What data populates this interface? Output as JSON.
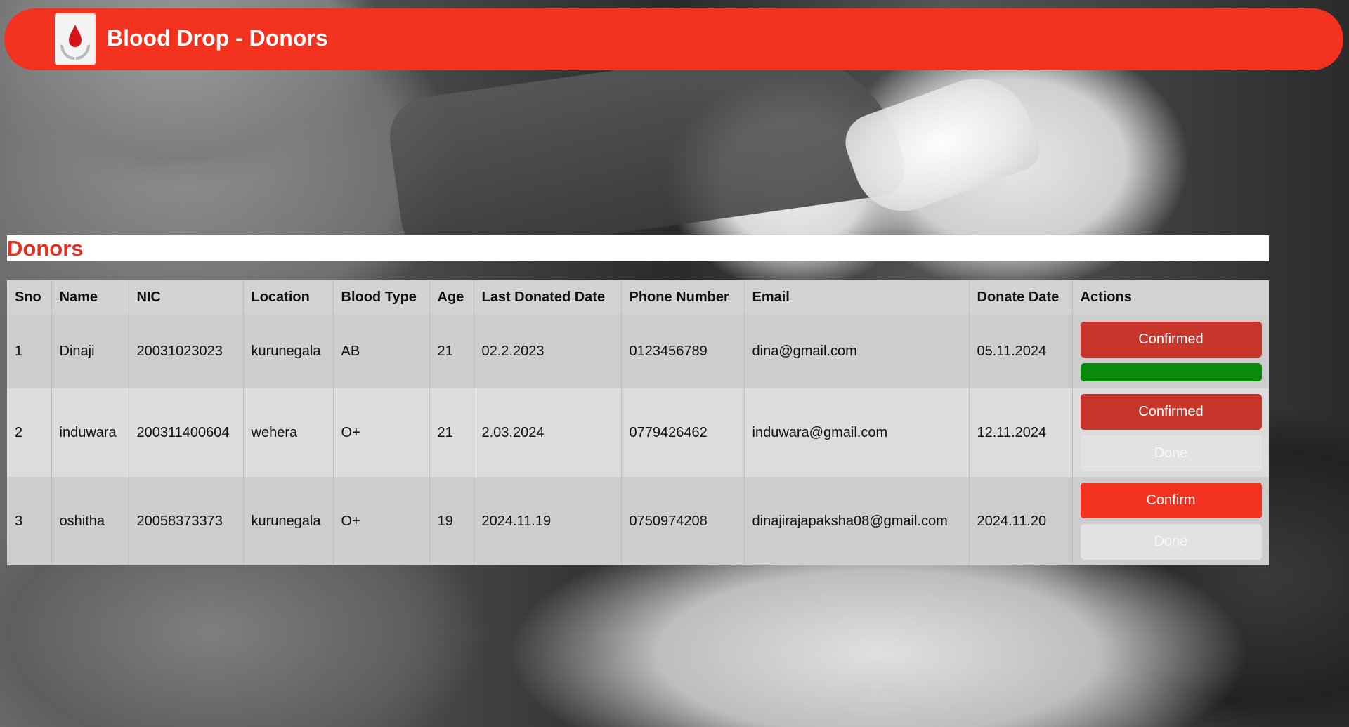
{
  "header": {
    "title": "Blood Drop - Donors",
    "logo_icon": "blood-drop-hands-icon"
  },
  "section": {
    "title": "Donors"
  },
  "colors": {
    "brand_red": "#f2311e",
    "confirmed_red": "#c8352b",
    "done_green": "#0a8a0a"
  },
  "table": {
    "headers": [
      "Sno",
      "Name",
      "NIC",
      "Location",
      "Blood Type",
      "Age",
      "Last Donated Date",
      "Phone Number",
      "Email",
      "Donate Date",
      "Actions"
    ],
    "rows": [
      {
        "sno": "1",
        "name": "Dinaji",
        "nic": "20031023023",
        "location": "kurunegala",
        "blood_type": "AB",
        "age": "21",
        "last_donated": "02.2.2023",
        "phone": "0123456789",
        "email": "dina@gmail.com",
        "donate_date": "05.11.2024",
        "primary_action": "Confirmed",
        "secondary_action": ""
      },
      {
        "sno": "2",
        "name": "induwara",
        "nic": "200311400604",
        "location": "wehera",
        "blood_type": "O+",
        "age": "21",
        "last_donated": "2.03.2024",
        "phone": "0779426462",
        "email": "induwara@gmail.com",
        "donate_date": "12.11.2024",
        "primary_action": "Confirmed",
        "secondary_action": "Done"
      },
      {
        "sno": "3",
        "name": "oshitha",
        "nic": "20058373373",
        "location": "kurunegala",
        "blood_type": "O+",
        "age": "19",
        "last_donated": "2024.11.19",
        "phone": "0750974208",
        "email": "dinajirajapaksha08@gmail.com",
        "donate_date": "2024.11.20",
        "primary_action": "Confirm",
        "secondary_action": "Done"
      }
    ]
  }
}
